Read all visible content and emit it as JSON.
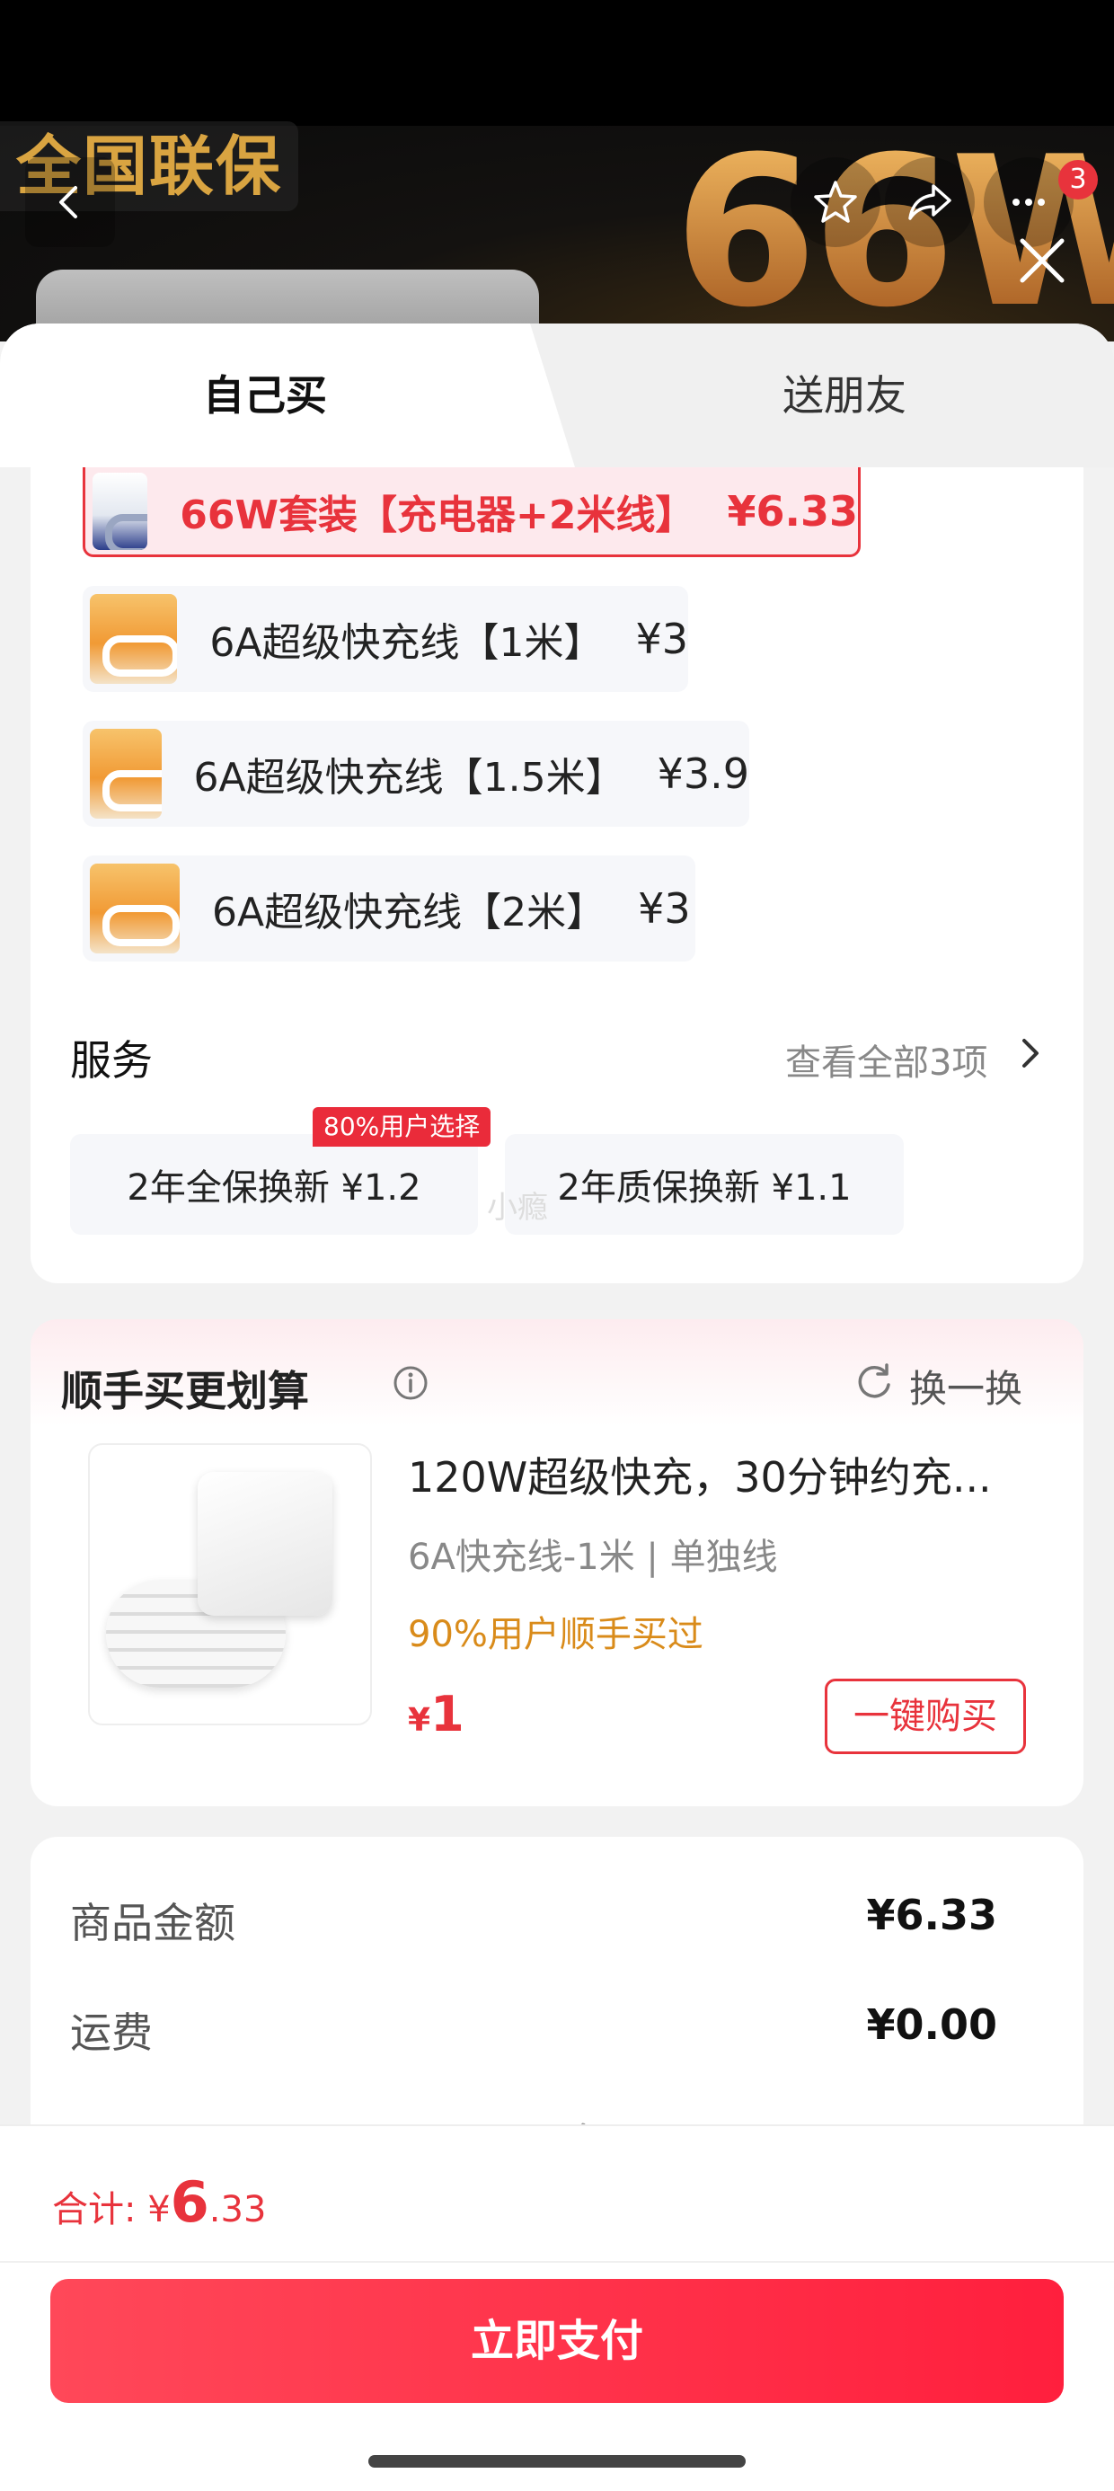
{
  "banner": {
    "tag": "全国联保",
    "big_text": "66W",
    "cart_count": "3"
  },
  "tabs": {
    "self": "自己买",
    "friend": "送朋友"
  },
  "options": [
    {
      "label": "66W套装【充电器+2米线】",
      "price": "¥6.33",
      "selected": true
    },
    {
      "label": "6A超级快充线【1米】",
      "price": "¥3",
      "selected": false
    },
    {
      "label": "6A超级快充线【1.5米】",
      "price": "¥3.9",
      "selected": false
    },
    {
      "label": "6A超级快充线【2米】",
      "price": "¥3",
      "selected": false
    }
  ],
  "service": {
    "title": "服务",
    "view_all": "查看全部3项",
    "badge": "80%用户选择",
    "items": [
      {
        "label": "2年全保换新 ¥1.2"
      },
      {
        "label": "2年质保换新 ¥1.1"
      }
    ],
    "watermark": "小瘾"
  },
  "upsell": {
    "title": "顺手买更划算",
    "swap": "换一换",
    "name": "120W超级快充，30分钟约充...",
    "spec": "6A快充线-1米 | 单独线",
    "hint": "90%用户顺手买过",
    "currency": "¥",
    "price": "1",
    "buy_button": "一键购买"
  },
  "summary": {
    "goods_label": "商品金额",
    "goods_value": "¥6.33",
    "shipping_label": "运费",
    "shipping_value": "¥0.00",
    "more": "展开更多"
  },
  "footer": {
    "total_label": "合计: ",
    "currency": "¥",
    "total_int": "6",
    "total_dec": ".33",
    "pay_button": "立即支付"
  },
  "colors": {
    "accent": "#e8333c",
    "hint": "#d98b1a"
  }
}
